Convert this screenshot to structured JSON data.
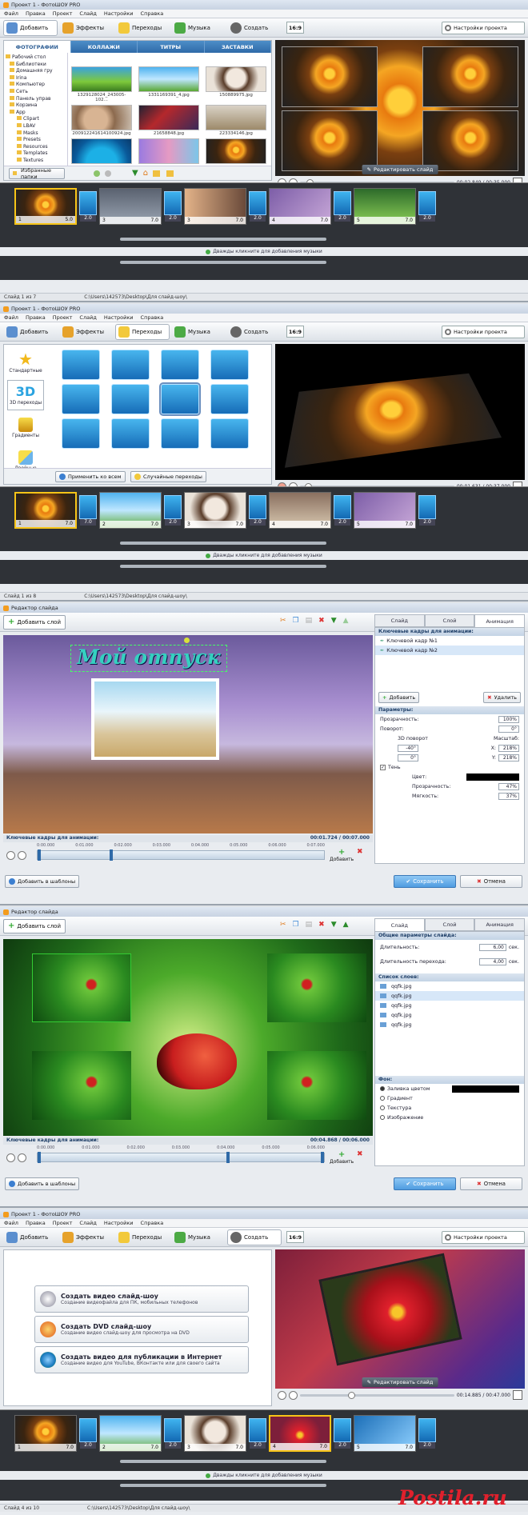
{
  "s1": {
    "title": "Проект 1 - ФотоШОУ PRO",
    "menu": [
      "Файл",
      "Правка",
      "Проект",
      "Слайд",
      "Настройки",
      "Справка"
    ],
    "toolbar": [
      "Добавить",
      "Эффекты",
      "Переходы",
      "Музыка",
      "Создать"
    ],
    "ratio": "16:9",
    "project_settings": "Настройки проекта",
    "tabs": [
      "ФОТОГРАФИИ",
      "КОЛЛАЖИ",
      "ТИТРЫ",
      "ЗАСТАВКИ"
    ],
    "tree": [
      "Рабочий стол",
      "Библиотеки",
      "Домашняя гру",
      "Irina",
      "Компьютер",
      "Сеть",
      "Панель управ",
      "Корзина",
      "App",
      "Clipart",
      "LBAV",
      "Masks",
      "Presets",
      "Resources",
      "Templates",
      "Textures"
    ],
    "files": [
      "1329128024_243005-102...",
      "1331169391_4.jpg",
      "150889975.jpg",
      "200912241614100924.jpg",
      "21658848.jpg",
      "223334146.jpg",
      "",
      "",
      ""
    ],
    "favorites": "Избранные папки",
    "edit_slide": "Редактировать слайд",
    "time": "00:02.849 / 00:35.000",
    "slides": [
      {
        "n": "1",
        "d": "5.0"
      },
      {
        "n": "3",
        "d": "7.0"
      },
      {
        "n": "3",
        "d": "7.0"
      },
      {
        "n": "4",
        "d": "7.0"
      },
      {
        "n": "5",
        "d": "7.0"
      },
      {
        "n": "6",
        "d": "7.0"
      }
    ],
    "trans": [
      "2.0",
      "2.0",
      "2.0",
      "2.0",
      "2.0",
      "2.0"
    ],
    "music_hint": "Дважды кликните для добавления музыки",
    "status_left": "Слайд 1 из 7",
    "status_path": "C:\\Users\\142573\\Desktop\\Для слайд-шоу\\"
  },
  "s2": {
    "title": "Проект 1 - ФотоШОУ PRO",
    "categories": [
      "Стандартные",
      "3D переходы",
      "Градиенты",
      "Двойные"
    ],
    "apply_all": "Применить ко всем",
    "random": "Случайные переходы",
    "time": "00:01.631 / 00:37.000",
    "slides": [
      {
        "n": "1",
        "d": "7.0"
      },
      {
        "n": "2",
        "d": "7.0"
      },
      {
        "n": "3",
        "d": "7.0"
      },
      {
        "n": "4",
        "d": "7.0"
      },
      {
        "n": "5",
        "d": "7.0"
      },
      {
        "n": "6",
        "d": "7.0"
      }
    ],
    "trans": [
      "7.0",
      "2.0",
      "2.0",
      "2.0",
      "2.0",
      "2.0"
    ],
    "music_hint": "Дважды кликните для добавления музыки",
    "status_left": "Слайд 1 из 8",
    "status_path": "C:\\Users\\142573\\Desktop\\Для слайд-шоу\\"
  },
  "s3": {
    "title": "Редактор слайда",
    "add_layer": "Добавить слой",
    "tabs": [
      "Слайд",
      "Слой",
      "Анимация"
    ],
    "canvas_text": "Мой отпуск",
    "kf_head": "Ключевые кадры для анимации:",
    "keyframes": [
      "Ключевой кадр №1",
      "Ключевой кадр №2"
    ],
    "add": "Добавить",
    "del": "Удалить",
    "params": "Параметры:",
    "opacity": "Прозрачность:",
    "opacity_val": "100%",
    "rotate": "Поворот:",
    "rotate_val": "0°",
    "rot3d": "3D поворот",
    "scale": "Масштаб:",
    "v1": "-40°",
    "v2": "0°",
    "x": "X:",
    "xv": "218%",
    "y": "Y:",
    "yv": "218%",
    "shadow": "Тень",
    "color": "Цвет:",
    "shadow_op": "Прозрачность:",
    "shadow_op_val": "47%",
    "soft": "Мягкость:",
    "soft_val": "37%",
    "kf_bar": "Ключевые кадры для анимации:",
    "kf_time": "00:01.724 / 00:07.000",
    "ruler": [
      "0:00.000",
      "0:01.000",
      "0:02.000",
      "0:03.000",
      "0:04.000",
      "0:05.000",
      "0:06.000",
      "0:07.000"
    ],
    "add_tpl": "Добавить в шаблоны",
    "save": "Сохранить",
    "cancel": "Отмена",
    "kf_add": "Добавить"
  },
  "s4": {
    "title": "Редактор слайда",
    "add_layer": "Добавить слой",
    "tabs": [
      "Слайд",
      "Слой",
      "Анимация"
    ],
    "general": "Общие параметры слайда:",
    "duration": "Длительность:",
    "duration_val": "6,00",
    "sec": "сек.",
    "trans_dur": "Длительность перехода:",
    "trans_dur_val": "4,00",
    "layers_head": "Список слоев:",
    "layers": [
      "qqfk.jpg",
      "qqfk.jpg",
      "qqfk.jpg",
      "qqfk.jpg",
      "qqfk.jpg"
    ],
    "bg_head": "Фон:",
    "bg_opts": [
      "Заливка цветом",
      "Градиент",
      "Текстура",
      "Изображение"
    ],
    "kf_bar": "Ключевые кадры для анимации:",
    "kf_time": "00:04.868 / 00:06.000",
    "ruler": [
      "0:00.000",
      "0:01.000",
      "0:02.000",
      "0:03.000",
      "0:04.000",
      "0:05.000",
      "0:06.000"
    ],
    "add_tpl": "Добавить в шаблоны",
    "save": "Сохранить",
    "cancel": "Отмена",
    "kf_add": "Добавить"
  },
  "s5": {
    "title": "Проект 1 - ФотоШОУ PRO",
    "b1t": "Создать видео слайд-шоу",
    "b1s": "Создание видеофайла для ПК, мобильных телефонов",
    "b2t": "Создать DVD слайд-шоу",
    "b2s": "Создание видео слайд-шоу для просмотра на DVD",
    "b3t": "Создать видео для публикации в Интернет",
    "b3s": "Создание видео для YouTube, ВКонтакте или для своего сайта",
    "edit_slide": "Редактировать слайд",
    "time": "00:14.885 / 00:47.000",
    "slides": [
      {
        "n": "1",
        "d": "7.0"
      },
      {
        "n": "2",
        "d": "7.0"
      },
      {
        "n": "3",
        "d": "7.0"
      },
      {
        "n": "4",
        "d": "7.0"
      },
      {
        "n": "5",
        "d": "7.0"
      },
      {
        "n": "6",
        "d": "7.0"
      }
    ],
    "trans": [
      "2.0",
      "2.0",
      "2.0",
      "2.0",
      "2.0",
      "2.0"
    ],
    "music_hint": "Дважды кликните для добавления музыки",
    "status_left": "Слайд 4 из 10",
    "status_path": "C:\\Users\\142573\\Desktop\\Для слайд-шоу\\",
    "watermark": "Postila.ru"
  },
  "colors": {
    "accent": "#2f6aa8",
    "save": "#5fa8e8",
    "timeline": "#2f3237"
  }
}
